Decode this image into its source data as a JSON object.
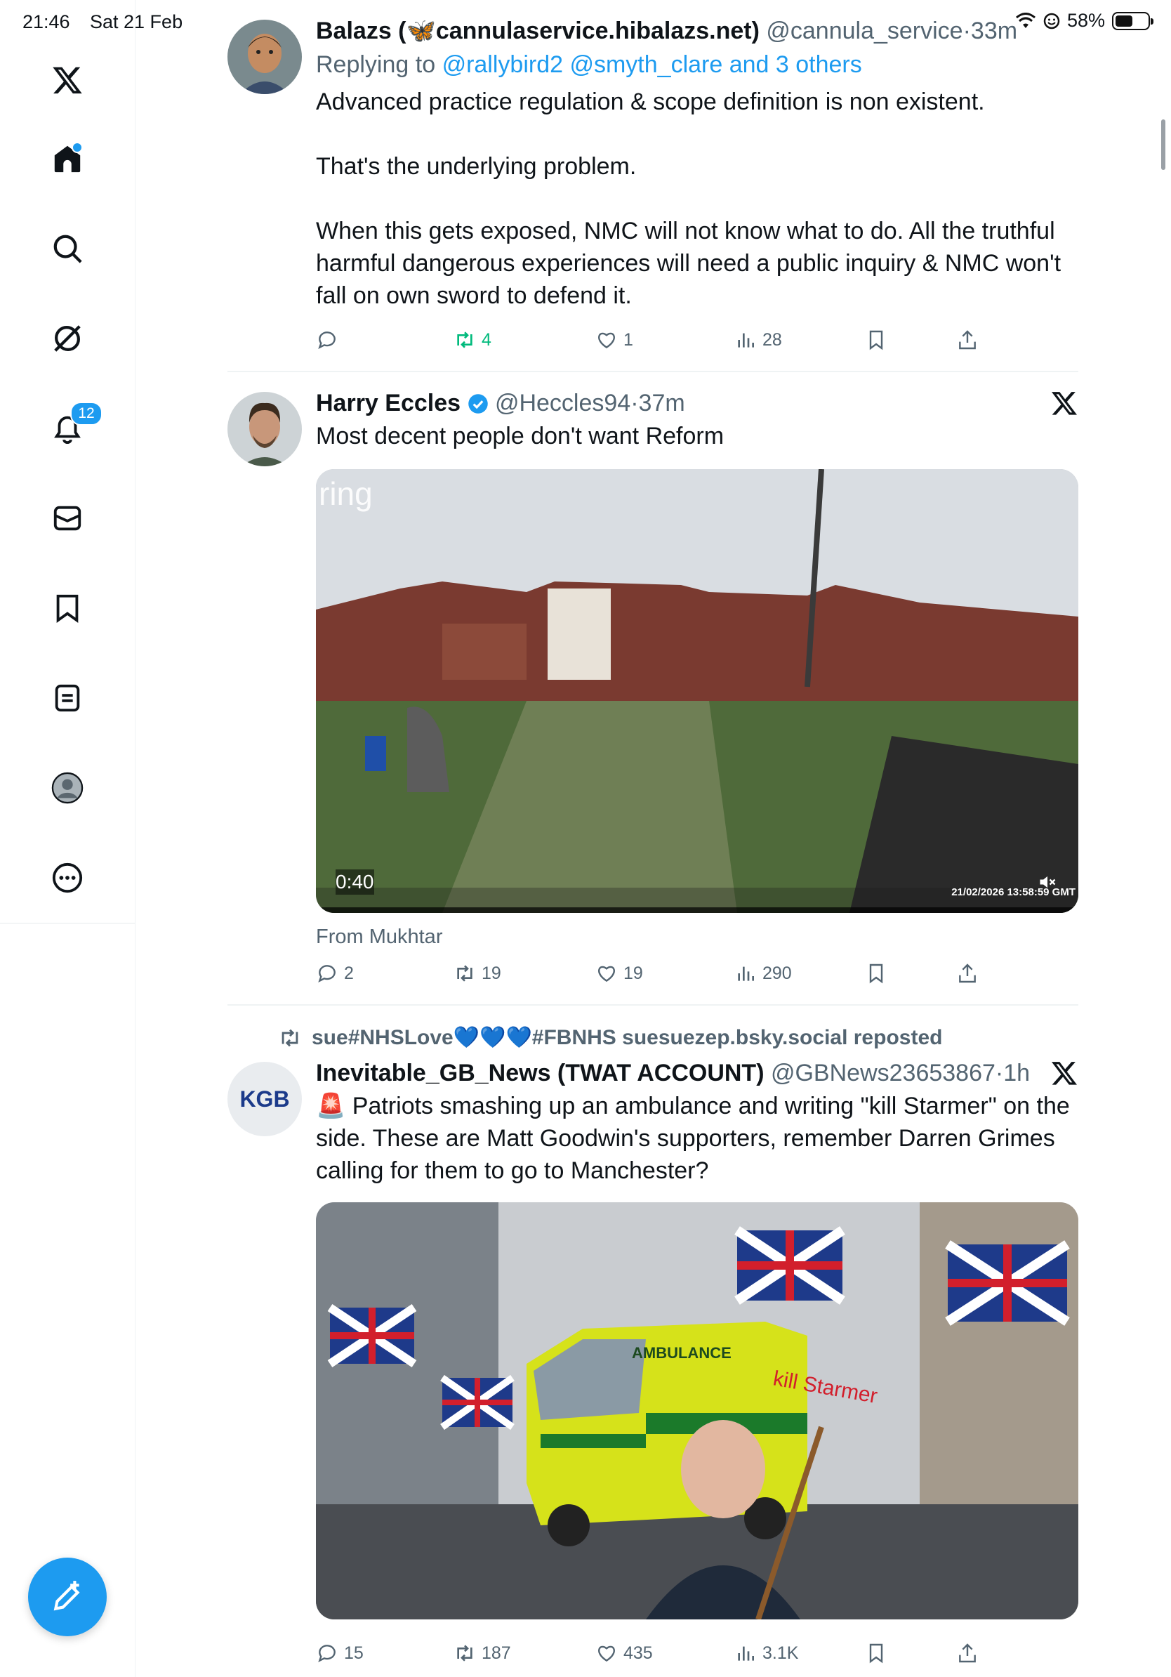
{
  "status_bar": {
    "time": "21:46",
    "date": "Sat 21 Feb",
    "battery": "58%",
    "battery_level": 0.58
  },
  "sidebar": {
    "items": [
      {
        "name": "x-logo",
        "icon": "x-logo-icon"
      },
      {
        "name": "home",
        "icon": "home-icon",
        "has_dot": true
      },
      {
        "name": "explore",
        "icon": "search-icon"
      },
      {
        "name": "grok",
        "icon": "grok-icon"
      },
      {
        "name": "notifications",
        "icon": "bell-icon",
        "badge": "12"
      },
      {
        "name": "messages",
        "icon": "mail-icon"
      },
      {
        "name": "bookmarks",
        "icon": "bookmark-icon"
      },
      {
        "name": "lists",
        "icon": "list-icon"
      },
      {
        "name": "profile",
        "icon": "profile-icon"
      },
      {
        "name": "more",
        "icon": "more-icon"
      }
    ],
    "compose_icon": "compose-icon"
  },
  "tweets": [
    {
      "name": "Balazs (🦋cannulaservice.hibalazs.net)",
      "handle": "@cannula_service",
      "time": "33m",
      "reply_prefix": "Replying to",
      "reply_mentions": "@rallybird2 @smyth_clare and 3 others",
      "text": "Advanced practice regulation & scope definition is non existent.\n\nThat's the underlying problem.\n\nWhen this gets exposed, NMC will not know what to do. All the truthful harmful dangerous experiences will need a public inquiry & NMC won't fall on own sword to defend it.",
      "replies": "",
      "reposts": "4",
      "likes": "1",
      "views": "28",
      "repost_color": "#00ba7c"
    },
    {
      "name": "Harry Eccles",
      "handle": "@Heccles94",
      "time": "37m",
      "text": "Most decent people don't want Reform",
      "video_brand": "ring",
      "video_duration": "0:40",
      "video_timestamp": "21/02/2026 13:58:59 GMT",
      "from": "From Mukhtar",
      "replies": "2",
      "reposts": "19",
      "likes": "19",
      "views": "290"
    },
    {
      "repost_by": "sue#NHSLove💙💙💙#FBNHS suesuezep.bsky.social reposted",
      "name": "Inevitable_GB_News (TWAT ACCOUNT)",
      "handle": "@GBNews23653867",
      "time": "1h",
      "avatar_text": "KGB",
      "text": "🚨 Patriots smashing up an ambulance and writing \"kill Starmer\" on the side. These are Matt Goodwin's supporters, remember Darren Grimes calling for them to go to Manchester?",
      "image_text_1": "AMBULANCE",
      "image_text_2": "kill Starmer",
      "replies": "15",
      "reposts": "187",
      "likes": "435",
      "views": "3.1K"
    }
  ]
}
